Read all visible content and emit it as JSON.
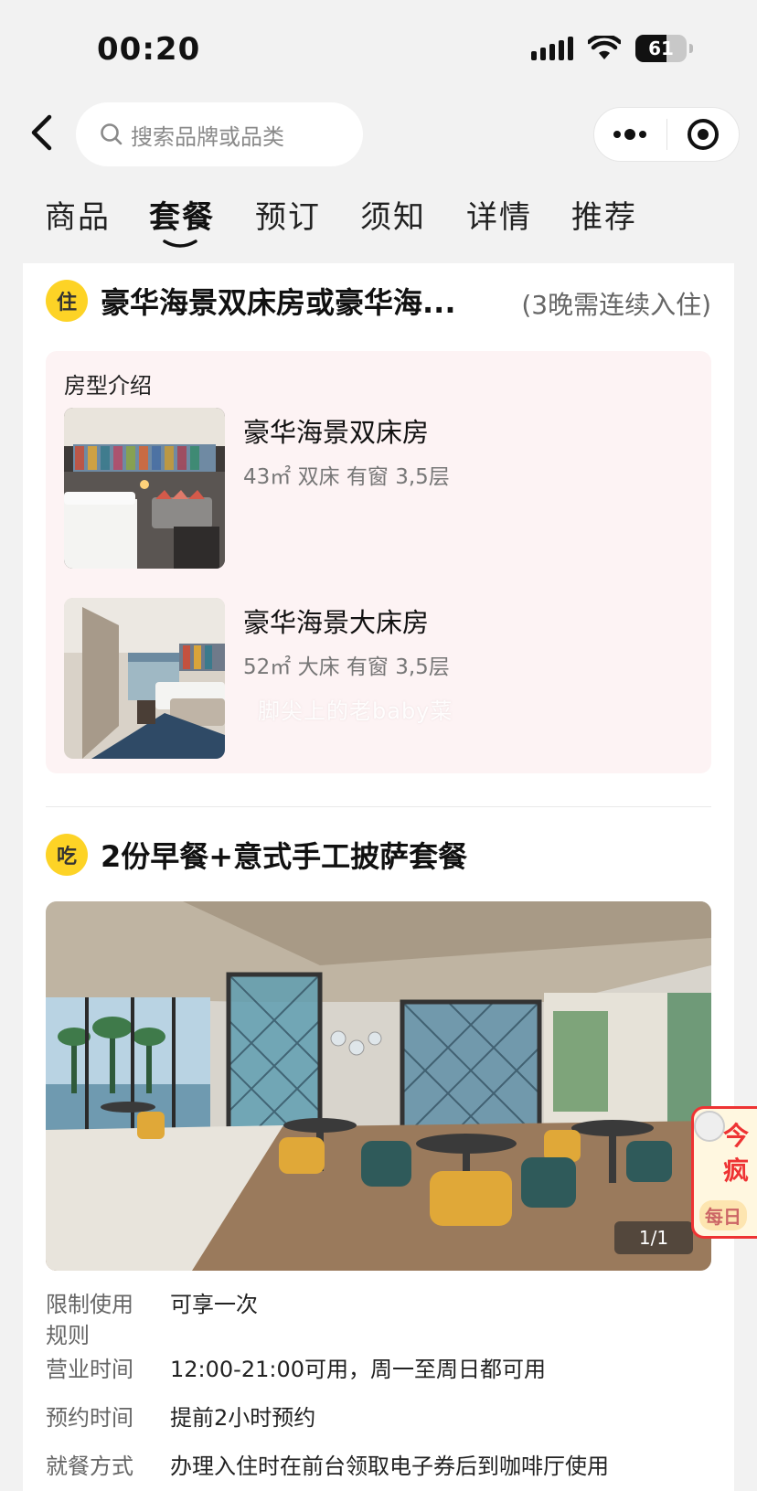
{
  "status_bar": {
    "time": "00:20",
    "battery": "61",
    "battery_level_percent": 61,
    "icons": [
      "signal-icon",
      "wifi-icon",
      "battery-icon"
    ]
  },
  "nav": {
    "search_placeholder": "搜索品牌或品类",
    "icons": [
      "back-icon",
      "search-icon",
      "more-icon",
      "target-icon"
    ]
  },
  "tabs": [
    {
      "label": "商品",
      "active": false
    },
    {
      "label": "套餐",
      "active": true
    },
    {
      "label": "预订",
      "active": false
    },
    {
      "label": "须知",
      "active": false
    },
    {
      "label": "详情",
      "active": false
    },
    {
      "label": "推荐",
      "active": false
    }
  ],
  "accent_color": "#fdd326",
  "stay_section": {
    "badge": "住",
    "title": "豪华海景双床房或豪华海...",
    "note": "(3晚需连续入住)",
    "room_intro_title": "房型介绍",
    "rooms": [
      {
        "name": "豪华海景双床房",
        "specs": "43㎡  双床  有窗  3,5层"
      },
      {
        "name": "豪华海景大床房",
        "specs": "52㎡  大床  有窗  3,5层"
      }
    ],
    "watermark": "脚尖上的老baby菜"
  },
  "dining_section": {
    "badge": "吃",
    "title": "2份早餐+意式手工披萨套餐",
    "photo_counter": "1/1",
    "rules": [
      {
        "label": "限制使用规则",
        "value": "可享一次"
      },
      {
        "label": "营业时间",
        "value": "12:00-21:00可用，周一至周日都可用"
      },
      {
        "label": "预约时间",
        "value": "提前2小时预约"
      },
      {
        "label": "就餐方式",
        "value": "办理入住时在前台领取电子券后到咖啡厅使用"
      }
    ]
  },
  "promo": {
    "line1": "今",
    "line2": "疯",
    "line3": "每日"
  }
}
